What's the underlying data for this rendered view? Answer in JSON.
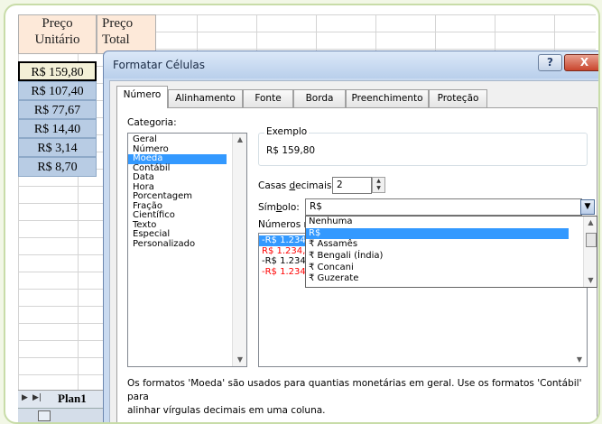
{
  "spreadsheet": {
    "headers": [
      "Preço Unitário",
      "Preço Total"
    ],
    "header_line1": [
      "Preço",
      "Preço"
    ],
    "header_line2": [
      "Unitário",
      "Total"
    ],
    "values": [
      "R$ 159,80",
      "R$ 107,40",
      "R$ 77,67",
      "R$ 14,40",
      "R$ 3,14",
      "R$ 8,70"
    ],
    "sheet_tab": "Plan1"
  },
  "dialog": {
    "title": "Formatar Células",
    "help_label": "?",
    "close_label": "X",
    "tabs": [
      "Número",
      "Alinhamento",
      "Fonte",
      "Borda",
      "Preenchimento",
      "Proteção"
    ],
    "category_label": "Categoria:",
    "categories": [
      "Geral",
      "Número",
      "Moeda",
      "Contábil",
      "Data",
      "Hora",
      "Porcentagem",
      "Fração",
      "Científico",
      "Texto",
      "Especial",
      "Personalizado"
    ],
    "selected_category": "Moeda",
    "sample_label": "Exemplo",
    "sample_value": "R$ 159,80",
    "decimals_label": "Casas decimais:",
    "decimals_value": "2",
    "symbol_label": "Símbolo:",
    "symbol_value": "R$",
    "negative_label": "Números n",
    "symbol_options": [
      "Nenhuma",
      "R$",
      "₹ Assamês",
      "₹ Bengali (Índia)",
      "₹ Concani",
      "₹ Guzerate"
    ],
    "negative_formats": [
      "-R$ 1.234",
      "R$ 1.234,",
      "-R$ 1.234,",
      "-R$ 1.234"
    ],
    "description_line1": "Os formatos 'Moeda' são usados para quantias monetárias em geral. Use os formatos 'Contábil' para",
    "description_line2": "alinhar vírgulas decimais em uma coluna."
  },
  "colors": {
    "selection": "#3399ff",
    "negative_red": "#ff0000",
    "header_fill": "#fde9d9",
    "value_fill": "#b8cce4"
  }
}
